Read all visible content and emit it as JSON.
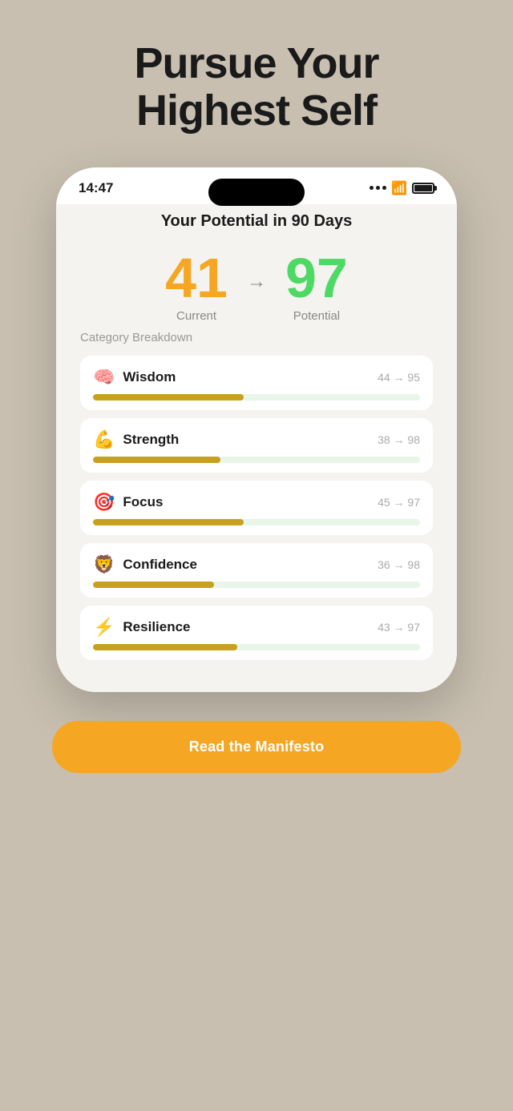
{
  "page": {
    "background_color": "#c8bfb0"
  },
  "headline": {
    "line1": "Pursue Your",
    "line2": "Highest Self"
  },
  "status_bar": {
    "time": "14:47"
  },
  "main_section": {
    "title": "Your Potential in 90 Days",
    "current_score": "41",
    "current_label": "Current",
    "potential_score": "97",
    "potential_label": "Potential",
    "arrow": "→",
    "category_breakdown_label": "Category Breakdown"
  },
  "categories": [
    {
      "emoji": "🧠",
      "name": "Wisdom",
      "current": 44,
      "potential": 95,
      "score_text": "44 → 95",
      "fill_percent": 46
    },
    {
      "emoji": "💪",
      "name": "Strength",
      "current": 38,
      "potential": 98,
      "score_text": "38 → 98",
      "fill_percent": 39
    },
    {
      "emoji": "🎯",
      "name": "Focus",
      "current": 45,
      "potential": 97,
      "score_text": "45 → 97",
      "fill_percent": 46
    },
    {
      "emoji": "🦁",
      "name": "Confidence",
      "current": 36,
      "potential": 98,
      "score_text": "36 → 98",
      "fill_percent": 37
    },
    {
      "emoji": "⚡",
      "name": "Resilience",
      "current": 43,
      "potential": 97,
      "score_text": "43 → 97",
      "fill_percent": 44
    }
  ],
  "cta": {
    "label": "Read the Manifesto"
  }
}
